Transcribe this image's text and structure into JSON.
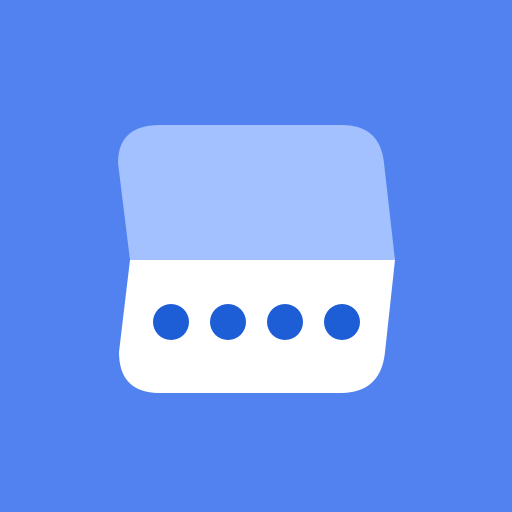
{
  "icon": {
    "semantic_name": "password-card-icon",
    "dots": 4
  },
  "colors": {
    "background": "#5282F0",
    "card_top": "#A3C0FF",
    "card_bottom": "#FFFFFF",
    "dot": "#1D5DD6"
  }
}
